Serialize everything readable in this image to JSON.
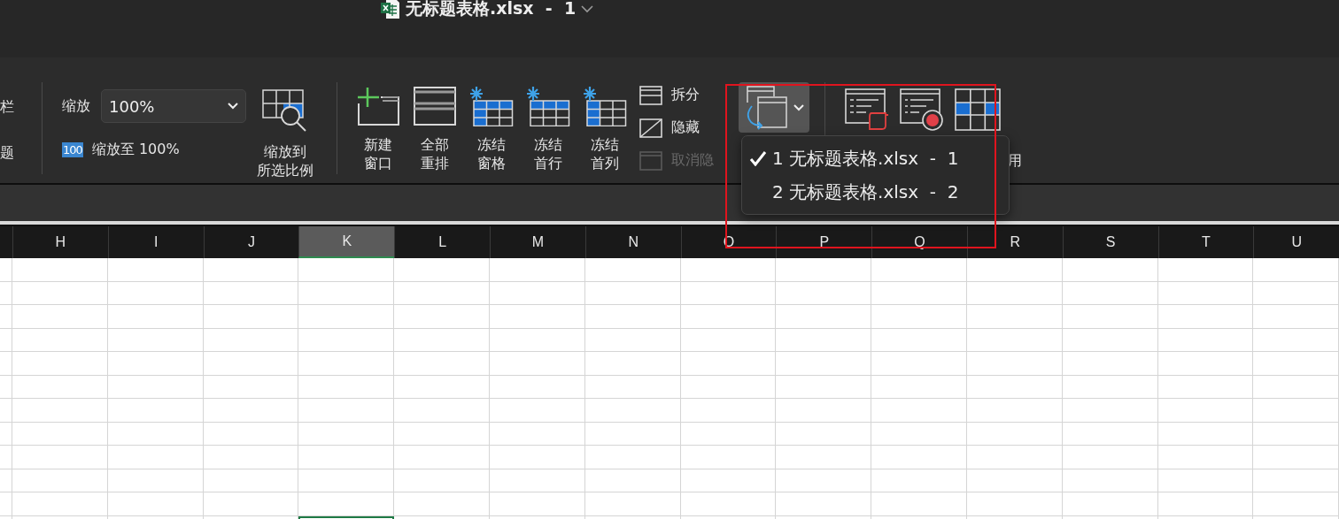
{
  "title_bar": {
    "title": "无标题表格.xlsx  -  1"
  },
  "ribbon": {
    "cut_labels": [
      "栏",
      "题"
    ],
    "zoom": {
      "label": "缩放",
      "value": "100%",
      "badge": "100",
      "zoom_100": "缩放至 100%",
      "zoom_selection": [
        "缩放到",
        "所选比例"
      ]
    },
    "window_buttons": [
      {
        "label": "新建窗口",
        "kind": "new-window"
      },
      {
        "label": "全部重排",
        "kind": "arrange"
      },
      {
        "label": "冻结窗格",
        "kind": "freeze-panes"
      },
      {
        "label": "冻结首行",
        "kind": "freeze-row"
      },
      {
        "label": "冻结首列",
        "kind": "freeze-column"
      }
    ],
    "view_options": [
      {
        "label": "拆分",
        "kind": "split",
        "disabled": false
      },
      {
        "label": "隐藏",
        "kind": "hide",
        "disabled": false
      },
      {
        "label": "取消隐",
        "kind": "unhide",
        "disabled": true
      }
    ],
    "switch_windows": {
      "expanded": true
    },
    "macro_buttons": [
      {
        "kind": "view-macros"
      },
      {
        "kind": "record-macro"
      },
      {
        "kind": "relative"
      }
    ],
    "macro_label": "用"
  },
  "window_menu": [
    {
      "label": "1 无标题表格.xlsx  -  1",
      "selected": true
    },
    {
      "label": "2 无标题表格.xlsx  -  2",
      "selected": false
    }
  ],
  "sheet": {
    "columns": [
      {
        "label": "H",
        "selected": false
      },
      {
        "label": "I",
        "selected": false
      },
      {
        "label": "J",
        "selected": false
      },
      {
        "label": "K",
        "selected": true
      },
      {
        "label": "L",
        "selected": false
      },
      {
        "label": "M",
        "selected": false
      },
      {
        "label": "N",
        "selected": false
      },
      {
        "label": "O",
        "selected": false
      },
      {
        "label": "P",
        "selected": false
      },
      {
        "label": "Q",
        "selected": false
      },
      {
        "label": "R",
        "selected": false
      },
      {
        "label": "S",
        "selected": false
      },
      {
        "label": "T",
        "selected": false
      },
      {
        "label": "U",
        "selected": false
      }
    ]
  }
}
